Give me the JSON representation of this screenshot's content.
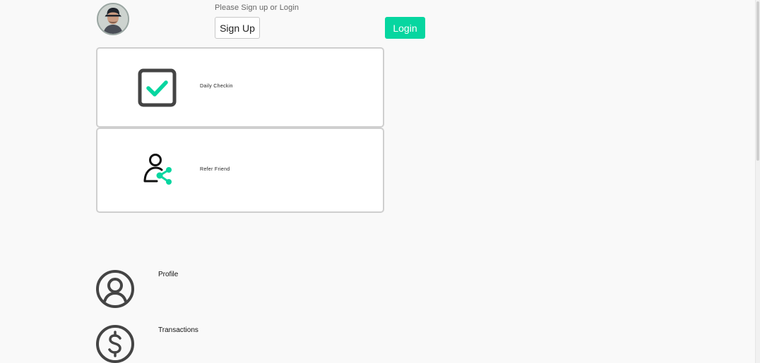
{
  "header": {
    "prompt": "Please Sign up or Login",
    "signup_label": "Sign Up",
    "login_label": "Login"
  },
  "cards": {
    "daily_checkin": "Daily Checkin",
    "refer_friend": "Refer Friend"
  },
  "menu": {
    "profile": "Profile",
    "transactions": "Transactions"
  },
  "colors": {
    "accent": "#06d6a0",
    "icon_dark": "#3f3f3f"
  },
  "icons": {
    "avatar": "user-photo",
    "checkin": "checkbox-checked-icon",
    "refer": "user-share-icon",
    "profile": "user-circle-icon",
    "transactions": "dollar-circle-icon"
  }
}
